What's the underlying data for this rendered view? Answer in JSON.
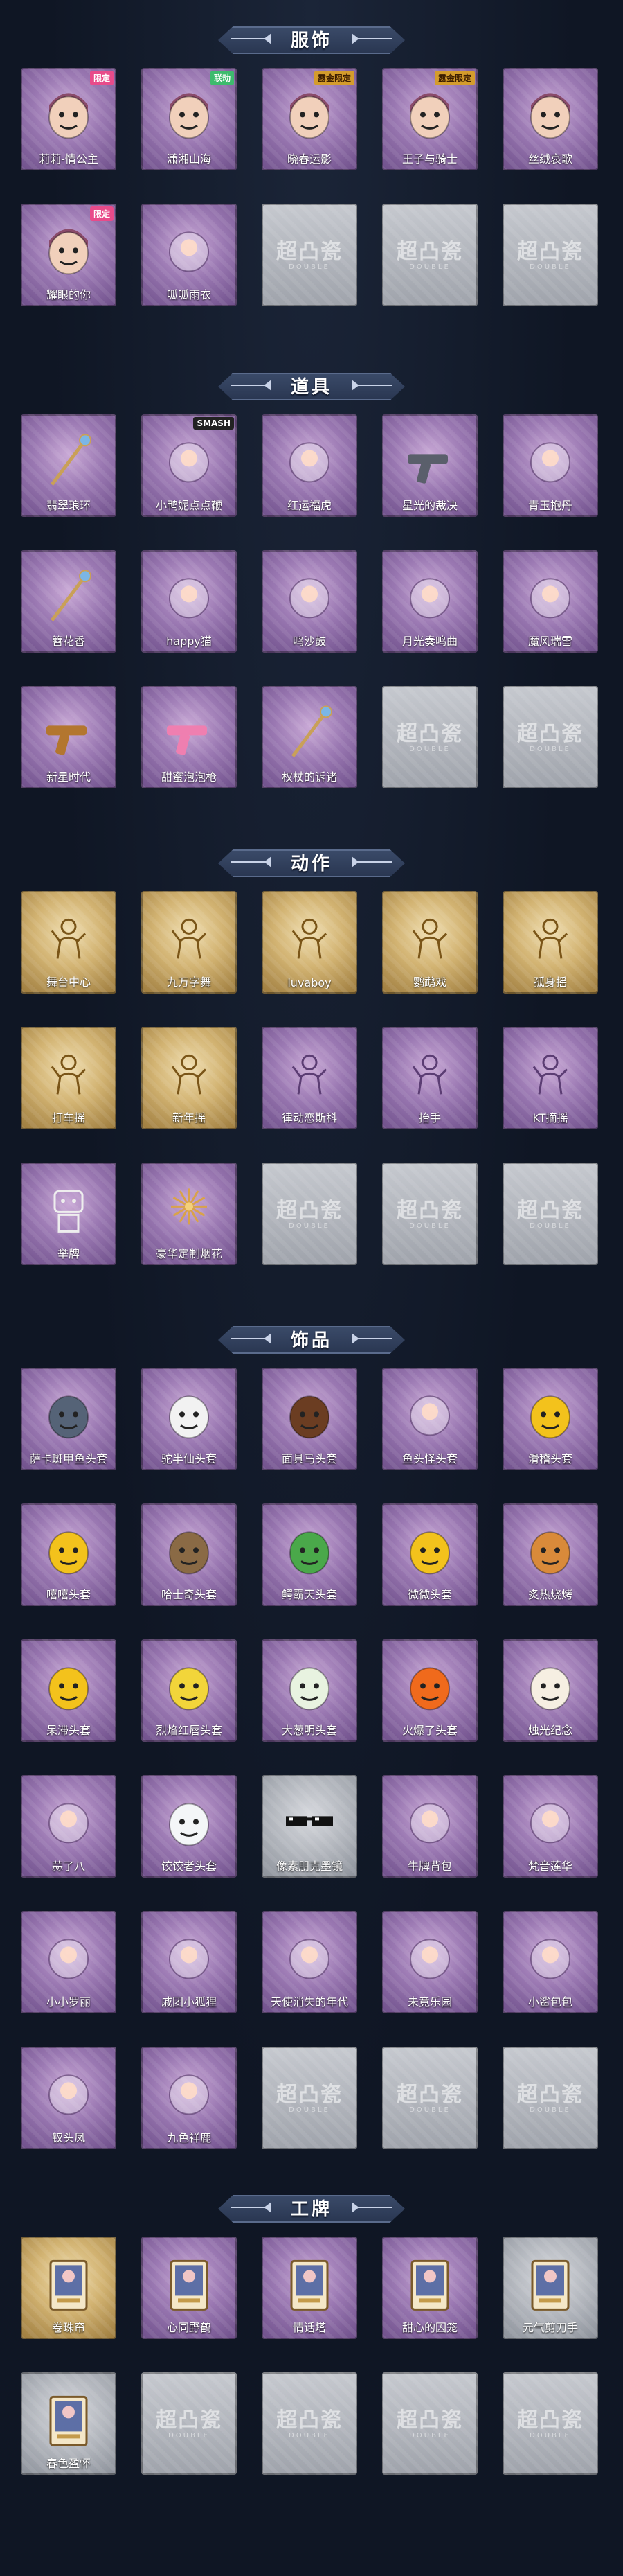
{
  "colors": {
    "background": "#0f1624",
    "header": "#2a3752",
    "purple": "#9a78b2",
    "gold": "#d2b372",
    "gray": "#aeb2b9"
  },
  "watermark": {
    "main": "超凸瓷",
    "sub": "DOUBLE"
  },
  "sections": [
    {
      "title": "服饰",
      "items": [
        {
          "label": "莉莉-情公主",
          "style": "purple",
          "icon": "doll-face-icon",
          "badge": "限定",
          "badge_style": "pink"
        },
        {
          "label": "潇湘山海",
          "style": "purple",
          "icon": "elf-face-icon",
          "badge": "联动",
          "badge_style": "green"
        },
        {
          "label": "晓春运影",
          "style": "purple",
          "icon": "boy-face-icon",
          "badge": "露金限定",
          "badge_style": "gold"
        },
        {
          "label": "王子与骑士",
          "style": "purple",
          "icon": "prince-face-icon",
          "badge": "露金限定",
          "badge_style": "gold"
        },
        {
          "label": "丝绒哀歌",
          "style": "purple",
          "icon": "gothic-face-icon"
        },
        {
          "label": "耀眼的你",
          "style": "purple",
          "icon": "cowgirl-face-icon",
          "badge": "限定",
          "badge_style": "pink"
        },
        {
          "label": "呱呱雨衣",
          "style": "purple",
          "icon": "frog-hood-icon"
        },
        {
          "label": "",
          "style": "empty"
        },
        {
          "label": "",
          "style": "empty"
        },
        {
          "label": "",
          "style": "empty"
        }
      ]
    },
    {
      "title": "道具",
      "items": [
        {
          "label": "翡翠琅环",
          "style": "purple",
          "icon": "jade-ring-icon"
        },
        {
          "label": "小鸭妮点点鞭",
          "style": "purple",
          "icon": "duck-toy-icon",
          "badge": "SMASH",
          "badge_style": "dark"
        },
        {
          "label": "红运福虎",
          "style": "purple",
          "icon": "tiger-icon"
        },
        {
          "label": "星光的裁决",
          "style": "purple",
          "icon": "rifle-icon"
        },
        {
          "label": "青玉抱丹",
          "style": "purple",
          "icon": "guitar-icon"
        },
        {
          "label": "簪花香",
          "style": "purple",
          "icon": "flower-branch-icon"
        },
        {
          "label": "happy猫",
          "style": "purple",
          "icon": "cat-statue-icon"
        },
        {
          "label": "鸣沙鼓",
          "style": "purple",
          "icon": "drum-icon"
        },
        {
          "label": "月光奏鸣曲",
          "style": "purple",
          "icon": "piano-icon"
        },
        {
          "label": "魔风瑞雪",
          "style": "purple",
          "icon": "snow-globe-icon"
        },
        {
          "label": "新星时代",
          "style": "purple",
          "icon": "revolver-icon"
        },
        {
          "label": "甜蜜泡泡枪",
          "style": "purple",
          "icon": "bubble-gun-icon"
        },
        {
          "label": "权杖的诉诸",
          "style": "purple",
          "icon": "scepter-icon"
        },
        {
          "label": "",
          "style": "empty"
        },
        {
          "label": "",
          "style": "empty"
        }
      ]
    },
    {
      "title": "动作",
      "items": [
        {
          "label": "舞台中心",
          "style": "gold",
          "icon": "pose-figure-icon"
        },
        {
          "label": "九万字舞",
          "style": "gold",
          "icon": "pose-figure-icon"
        },
        {
          "label": "luvaboy",
          "style": "gold",
          "icon": "pose-figure-icon"
        },
        {
          "label": "鹦鹉戏",
          "style": "gold",
          "icon": "pose-figure-icon"
        },
        {
          "label": "孤身摇",
          "style": "gold",
          "icon": "pose-figure-icon"
        },
        {
          "label": "打车摇",
          "style": "gold",
          "icon": "pose-figure-icon"
        },
        {
          "label": "新年摇",
          "style": "gold",
          "icon": "pose-figure-icon"
        },
        {
          "label": "律动恋斯科",
          "style": "purple",
          "icon": "pose-figure-icon"
        },
        {
          "label": "抬手",
          "style": "purple",
          "icon": "wave-hand-icon"
        },
        {
          "label": "KT摘摇",
          "style": "purple",
          "icon": "pose-figure-icon"
        },
        {
          "label": "举牌",
          "style": "purple",
          "icon": "robot-sign-icon"
        },
        {
          "label": "豪华定制烟花",
          "style": "purple",
          "icon": "fireworks-icon"
        },
        {
          "label": "",
          "style": "empty"
        },
        {
          "label": "",
          "style": "empty"
        },
        {
          "label": "",
          "style": "empty"
        }
      ]
    },
    {
      "title": "饰品",
      "items": [
        {
          "label": "萨卡斑甲鱼头套",
          "style": "purple",
          "icon": "fish-head-icon"
        },
        {
          "label": "驼半仙头套",
          "style": "purple",
          "icon": "panda-head-icon"
        },
        {
          "label": "面具马头套",
          "style": "purple",
          "icon": "horse-head-icon"
        },
        {
          "label": "鱼头怪头套",
          "style": "purple",
          "icon": "fish-monster-icon"
        },
        {
          "label": "滑稽头套",
          "style": "purple",
          "icon": "funny-face-icon"
        },
        {
          "label": "嘻嘻头套",
          "style": "purple",
          "icon": "grin-face-icon"
        },
        {
          "label": "哈士奇头套",
          "style": "purple",
          "icon": "husky-head-icon"
        },
        {
          "label": "鳄霸天头套",
          "style": "purple",
          "icon": "crocodile-head-icon"
        },
        {
          "label": "微微头套",
          "style": "purple",
          "icon": "smile-face-icon"
        },
        {
          "label": "炙热烧烤",
          "style": "purple",
          "icon": "bbq-head-icon"
        },
        {
          "label": "呆滞头套",
          "style": "purple",
          "icon": "daze-face-icon"
        },
        {
          "label": "烈焰红唇头套",
          "style": "purple",
          "icon": "pikachu-head-icon"
        },
        {
          "label": "大葱明头套",
          "style": "purple",
          "icon": "scallion-head-icon"
        },
        {
          "label": "火爆了头套",
          "style": "purple",
          "icon": "fire-head-icon"
        },
        {
          "label": "烛光纪念",
          "style": "purple",
          "icon": "candle-head-icon"
        },
        {
          "label": "蒜了八",
          "style": "purple",
          "icon": "garlic-icon"
        },
        {
          "label": "饺饺者头套",
          "style": "purple",
          "icon": "dumpling-head-icon"
        },
        {
          "label": "像素朋克墨镜",
          "style": "gray",
          "icon": "pixel-glasses-icon"
        },
        {
          "label": "牛牌背包",
          "style": "purple",
          "icon": "cow-bag-icon"
        },
        {
          "label": "梵音莲华",
          "style": "purple",
          "icon": "lotus-bag-icon"
        },
        {
          "label": "小小罗丽",
          "style": "purple",
          "icon": "little-doll-icon"
        },
        {
          "label": "戚团小狐狸",
          "style": "purple",
          "icon": "fox-pendant-icon"
        },
        {
          "label": "天使消失的年代",
          "style": "purple",
          "icon": "angel-charm-icon"
        },
        {
          "label": "未竟乐园",
          "style": "purple",
          "icon": "clown-doll-icon"
        },
        {
          "label": "小鲨包包",
          "style": "purple",
          "icon": "shark-bag-icon"
        },
        {
          "label": "钗头凤",
          "style": "purple",
          "icon": "phoenix-crown-icon"
        },
        {
          "label": "九色祥鹿",
          "style": "purple",
          "icon": "deer-pendant-icon"
        },
        {
          "label": "",
          "style": "empty"
        },
        {
          "label": "",
          "style": "empty"
        },
        {
          "label": "",
          "style": "empty"
        }
      ]
    },
    {
      "title": "工牌",
      "items": [
        {
          "label": "卷珠帘",
          "style": "gold",
          "icon": "card-badge-icon"
        },
        {
          "label": "心同野鹤",
          "style": "purple",
          "icon": "card-badge-icon"
        },
        {
          "label": "情话塔",
          "style": "purple",
          "icon": "card-badge-icon"
        },
        {
          "label": "甜心的囚笼",
          "style": "purple",
          "icon": "card-badge-icon"
        },
        {
          "label": "元气剪刀手",
          "style": "gray",
          "icon": "card-badge-icon"
        },
        {
          "label": "春色盈怀",
          "style": "gray",
          "icon": "card-badge-icon"
        },
        {
          "label": "",
          "style": "empty"
        },
        {
          "label": "",
          "style": "empty"
        },
        {
          "label": "",
          "style": "empty"
        },
        {
          "label": "",
          "style": "empty"
        }
      ]
    }
  ]
}
